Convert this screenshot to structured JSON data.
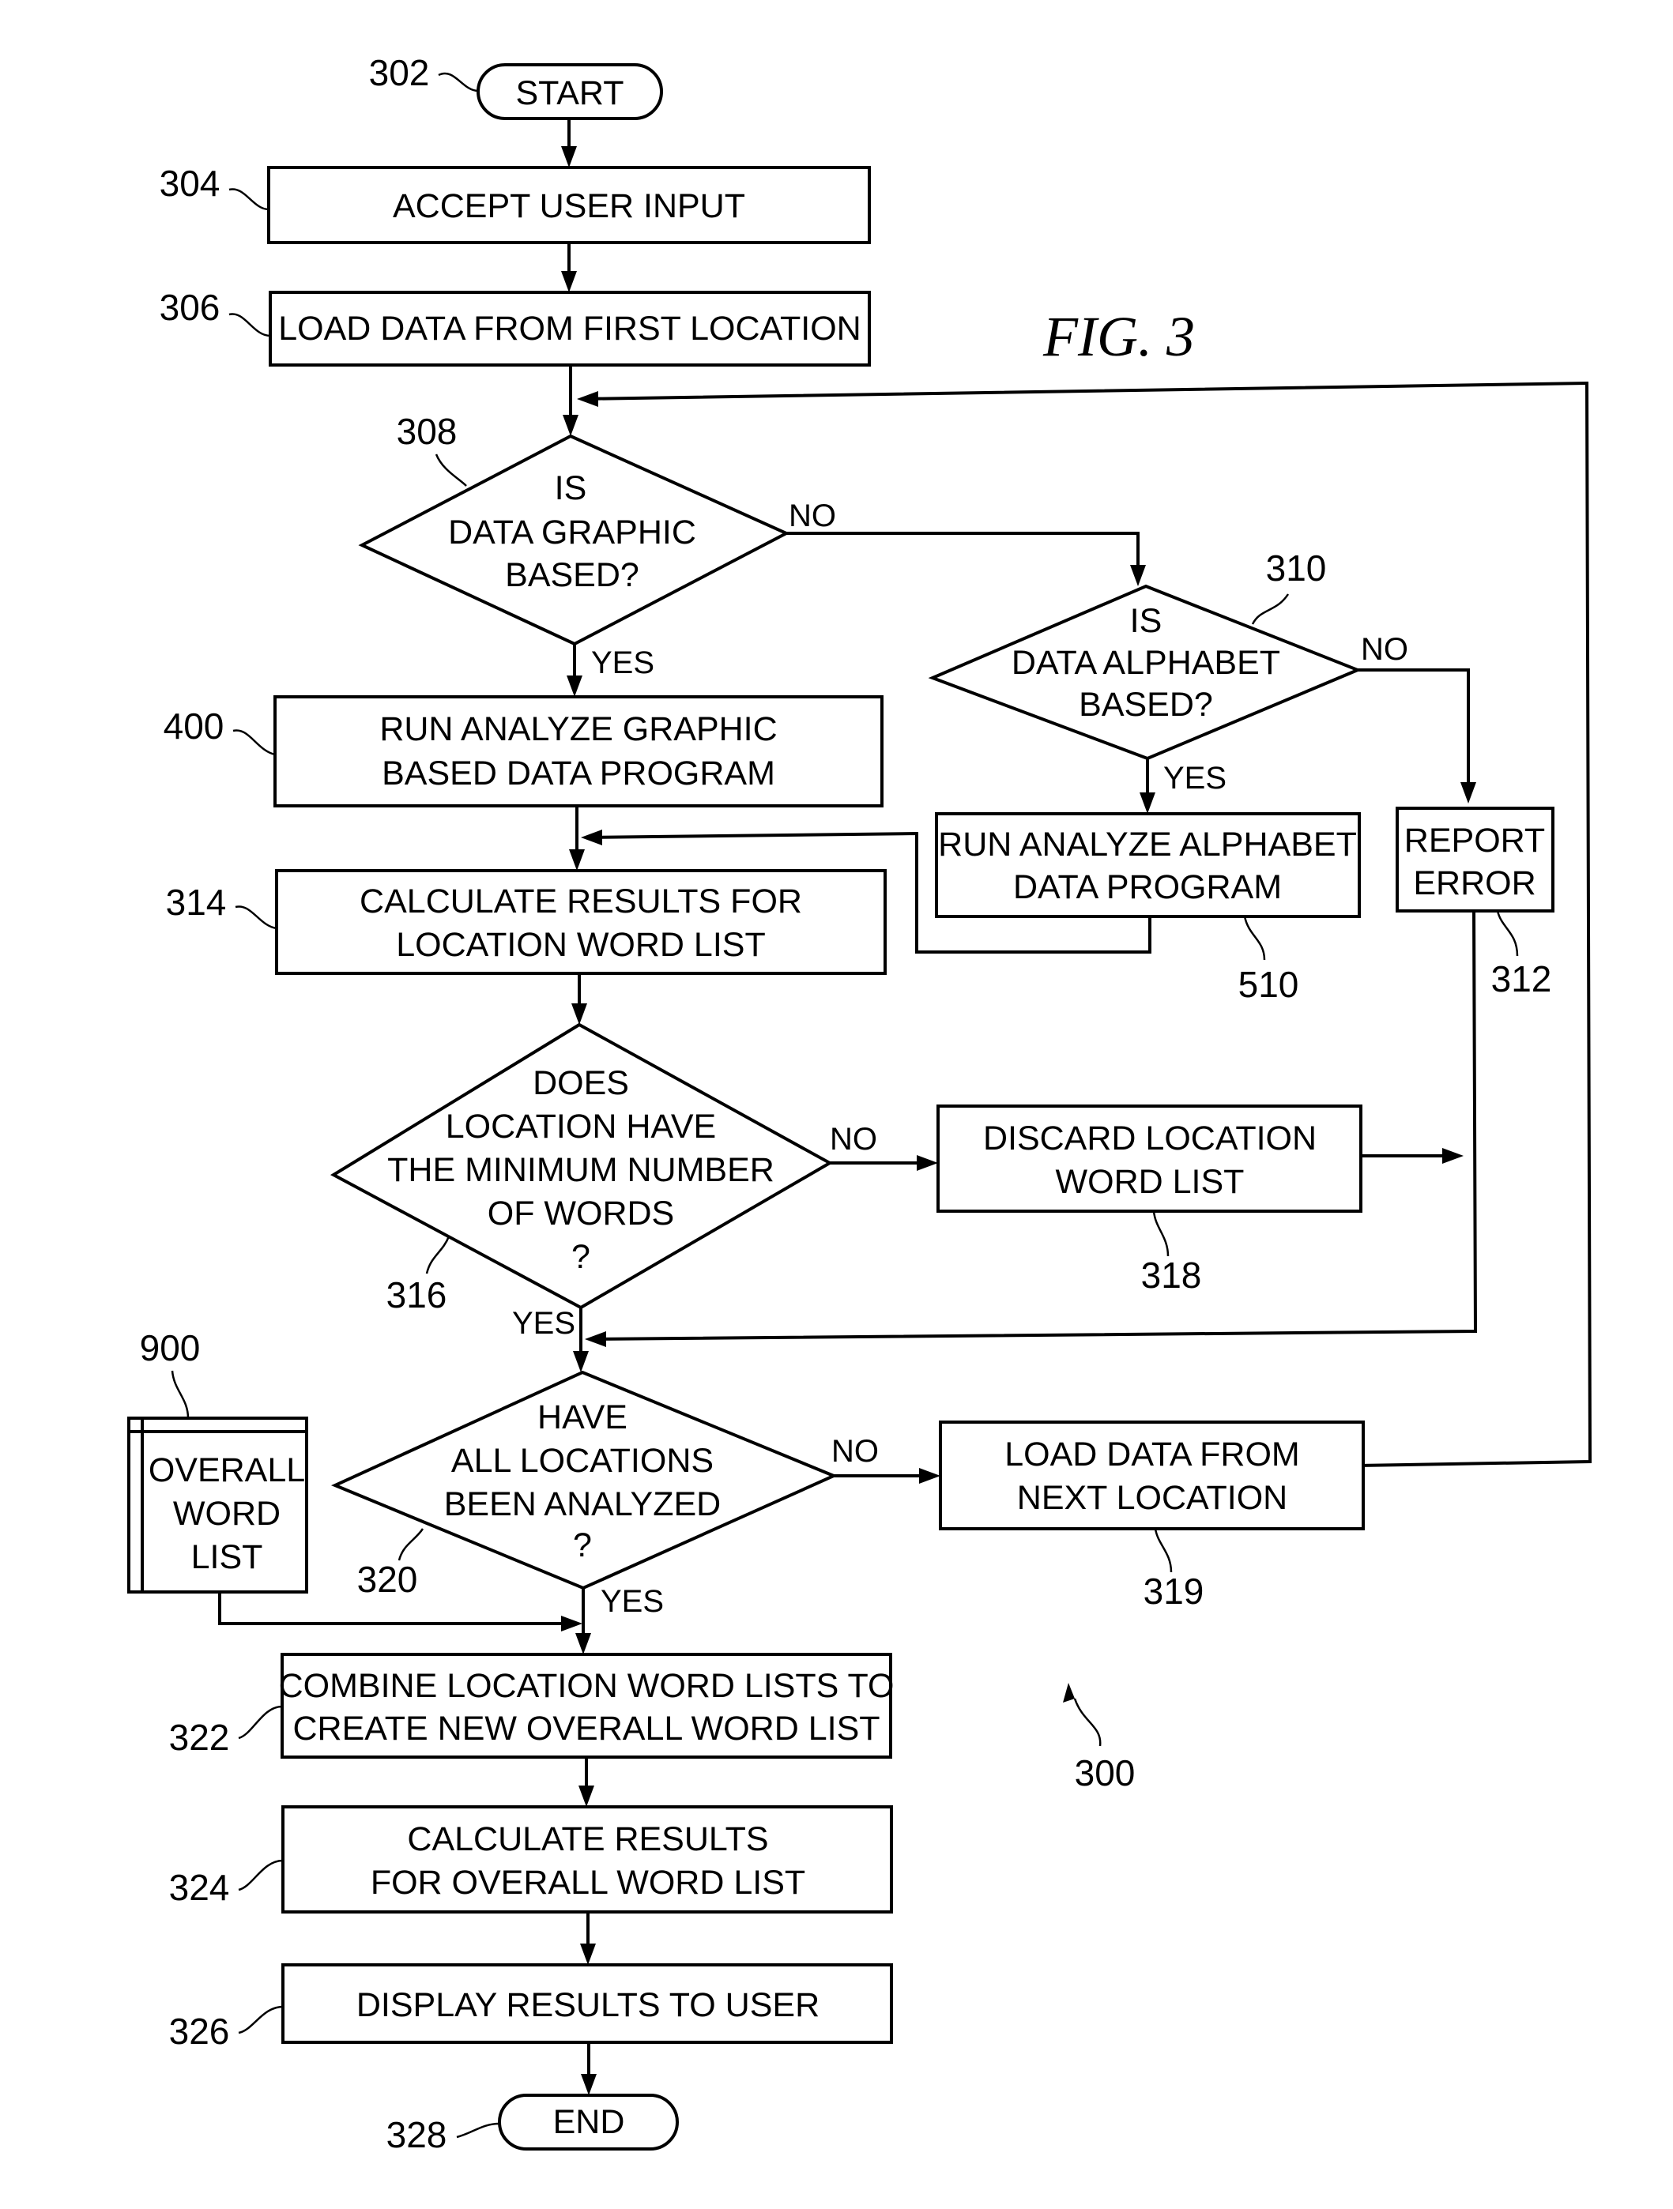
{
  "figure_title": "FIG. 3",
  "diagram_ref": "300",
  "nodes": {
    "start": {
      "ref": "302",
      "lines": [
        "START"
      ]
    },
    "accept_input": {
      "ref": "304",
      "lines": [
        "ACCEPT USER INPUT"
      ]
    },
    "load_first": {
      "ref": "306",
      "lines": [
        "LOAD DATA FROM FIRST LOCATION"
      ]
    },
    "is_graphic": {
      "ref": "308",
      "lines": [
        "IS",
        "DATA GRAPHIC",
        "BASED?"
      ]
    },
    "is_alphabet": {
      "ref": "310",
      "lines": [
        "IS",
        "DATA ALPHABET",
        "BASED?"
      ]
    },
    "run_graphic": {
      "ref": "400",
      "lines": [
        "RUN ANALYZE GRAPHIC",
        "BASED DATA PROGRAM"
      ]
    },
    "run_alphabet": {
      "ref": "510",
      "lines": [
        "RUN ANALYZE ALPHABET",
        "DATA PROGRAM"
      ]
    },
    "report_error": {
      "ref": "312",
      "lines": [
        "REPORT",
        "ERROR"
      ]
    },
    "calc_location": {
      "ref": "314",
      "lines": [
        "CALCULATE RESULTS FOR",
        "LOCATION WORD LIST"
      ]
    },
    "min_words": {
      "ref": "316",
      "lines": [
        "DOES",
        "LOCATION HAVE",
        "THE MINIMUM NUMBER",
        "OF WORDS",
        "?"
      ]
    },
    "discard": {
      "ref": "318",
      "lines": [
        "DISCARD LOCATION",
        "WORD LIST"
      ]
    },
    "all_analyzed": {
      "ref": "320",
      "lines": [
        "HAVE",
        "ALL LOCATIONS",
        "BEEN ANALYZED",
        "?"
      ]
    },
    "load_next": {
      "ref": "319",
      "lines": [
        "LOAD DATA FROM",
        "NEXT LOCATION"
      ]
    },
    "overall_list": {
      "ref": "900",
      "lines": [
        "OVERALL",
        "WORD",
        "LIST"
      ]
    },
    "combine": {
      "ref": "322",
      "lines": [
        "COMBINE LOCATION WORD LISTS TO",
        "CREATE NEW OVERALL WORD LIST"
      ]
    },
    "calc_overall": {
      "ref": "324",
      "lines": [
        "CALCULATE RESULTS",
        "FOR OVERALL WORD LIST"
      ]
    },
    "display": {
      "ref": "326",
      "lines": [
        "DISPLAY RESULTS TO USER"
      ]
    },
    "end": {
      "ref": "328",
      "lines": [
        "END"
      ]
    }
  },
  "branch_labels": {
    "graphic_no": "NO",
    "graphic_yes": "YES",
    "alphabet_no": "NO",
    "alphabet_yes": "YES",
    "min_no": "NO",
    "min_yes": "YES",
    "all_no": "NO",
    "all_yes": "YES"
  }
}
